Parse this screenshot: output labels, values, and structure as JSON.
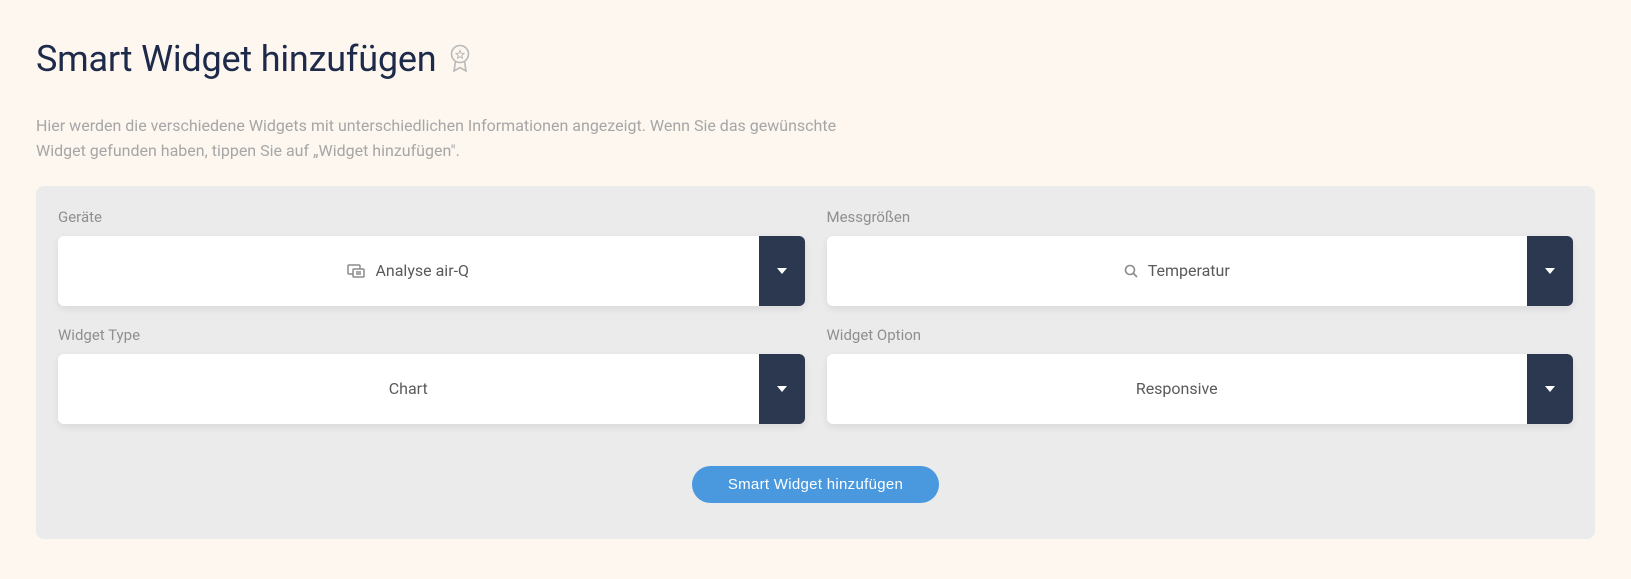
{
  "header": {
    "title": "Smart Widget hinzufügen"
  },
  "description": "Hier werden die verschiedene Widgets mit unterschiedlichen Informationen angezeigt. Wenn Sie das gewünschte Widget gefunden haben, tippen Sie auf „Widget hinzufügen\".",
  "fields": {
    "devices": {
      "label": "Geräte",
      "selected": "Analyse air-Q"
    },
    "measurements": {
      "label": "Messgrößen",
      "selected": "Temperatur"
    },
    "widget_type": {
      "label": "Widget Type",
      "selected": "Chart"
    },
    "widget_option": {
      "label": "Widget Option",
      "selected": "Responsive"
    }
  },
  "submit_label": "Smart Widget hinzufügen"
}
